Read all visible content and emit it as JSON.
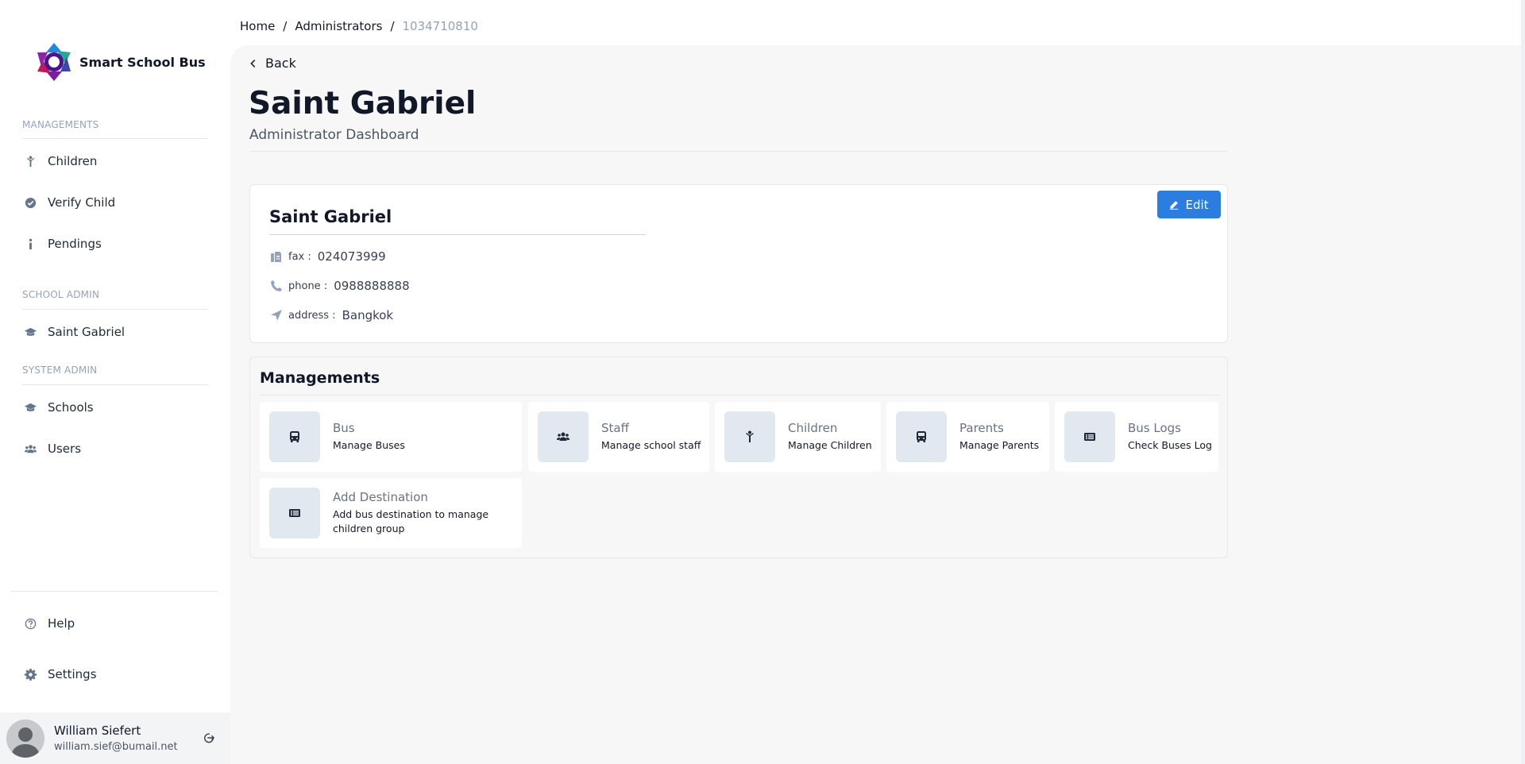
{
  "brand": {
    "name": "Smart School Bus",
    "logo_icon": "hexagon-flower-logo"
  },
  "sidebar": {
    "sections": [
      {
        "label": "MANAGEMENTS"
      },
      {
        "label": "SCHOOL ADMIN"
      },
      {
        "label": "SYSTEM ADMIN"
      }
    ],
    "items": [
      {
        "label": "Children",
        "icon": "child-icon"
      },
      {
        "label": "Verify Child",
        "icon": "badge-check-icon"
      },
      {
        "label": "Pendings",
        "icon": "info-icon"
      },
      {
        "label": "Saint Gabriel",
        "icon": "graduation-cap-icon"
      },
      {
        "label": "Schools",
        "icon": "graduation-cap-icon"
      },
      {
        "label": "Users",
        "icon": "users-icon"
      },
      {
        "label": "Help",
        "icon": "question-circle-icon"
      },
      {
        "label": "Settings",
        "icon": "gear-icon"
      }
    ]
  },
  "user": {
    "name": "William Siefert",
    "email": "william.sief@bumail.net"
  },
  "breadcrumb": {
    "home": "Home",
    "section": "Administrators",
    "current": "1034710810",
    "separator": "/"
  },
  "page": {
    "back_label": "Back",
    "title": "Saint Gabriel",
    "subtitle": "Administrator Dashboard"
  },
  "school": {
    "name": "Saint Gabriel",
    "edit_label": "Edit",
    "fields": [
      {
        "key": "fax :",
        "value": "024073999",
        "icon": "fax-icon"
      },
      {
        "key": "phone :",
        "value": "0988888888",
        "icon": "phone-icon"
      },
      {
        "key": "address :",
        "value": "Bangkok",
        "icon": "location-arrow-icon"
      }
    ]
  },
  "managements": {
    "title": "Managements",
    "tiles": [
      {
        "title": "Bus",
        "desc": "Manage Buses",
        "icon": "bus-icon"
      },
      {
        "title": "Staff",
        "desc": "Manage school staff",
        "icon": "users-icon"
      },
      {
        "title": "Children",
        "desc": "Manage Children",
        "icon": "child-icon"
      },
      {
        "title": "Parents",
        "desc": "Manage Parents",
        "icon": "bus-icon"
      },
      {
        "title": "Bus Logs",
        "desc": "Check Buses Log",
        "icon": "list-icon"
      },
      {
        "title": "Add Destination",
        "desc": "Add bus destination to manage children group",
        "icon": "list-icon"
      }
    ]
  },
  "colors": {
    "primary": "#2b7de0",
    "muted": "#94a3b8",
    "background": "#f7f7f7"
  }
}
